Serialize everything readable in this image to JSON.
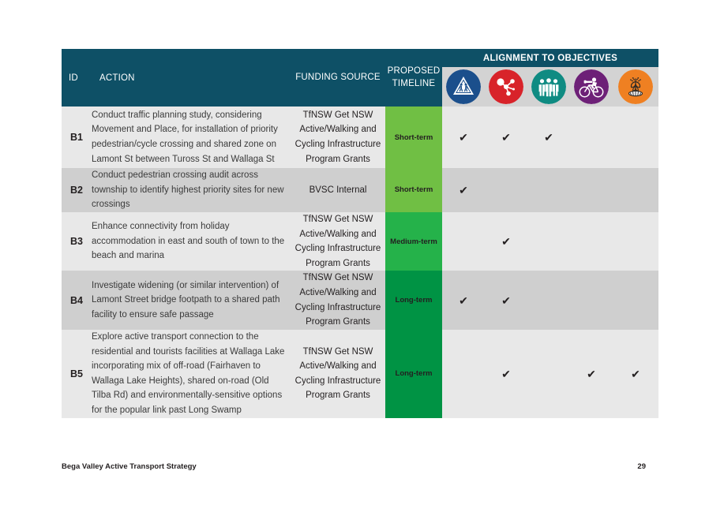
{
  "document": {
    "footer_title": "Bega Valley Active Transport Strategy",
    "page_number": "29"
  },
  "table": {
    "headers": {
      "id": "ID",
      "action": "ACTION",
      "funding_source": "FUNDING SOURCE",
      "proposed_timeline": "PROPOSED TIMELINE",
      "alignment_group": "ALIGNMENT TO OBJECTIVES"
    },
    "objectives": [
      {
        "name": "safety-pedestrian-crossing-icon",
        "color": "#1b4f8c",
        "label": "Safety"
      },
      {
        "name": "connected-network-icon",
        "color": "#d8232a",
        "label": "Connected network"
      },
      {
        "name": "community-people-icon",
        "color": "#0f8b82",
        "label": "Community"
      },
      {
        "name": "cycling-rider-icon",
        "color": "#6d2077",
        "label": "Cycling"
      },
      {
        "name": "environment-tree-icon",
        "color": "#ef8022",
        "label": "Environment"
      }
    ],
    "timeline_colors": {
      "short": "#70bf44",
      "medium": "#25b24a",
      "long": "#009344"
    },
    "header_color": "#0e5066",
    "tick_glyph": "✔",
    "rows": [
      {
        "id": "B1",
        "action": "Conduct traffic planning study, considering Movement and Place, for installation of priority pedestrian/cycle crossing and shared zone on Lamont St between Tuross St and Wallaga St",
        "funding_source": "TfNSW Get NSW Active/Walking and Cycling Infrastructure Program Grants",
        "timeline": "Short-term",
        "timeline_key": "short",
        "alignment": [
          true,
          true,
          true,
          false,
          false
        ],
        "shade": "light"
      },
      {
        "id": "B2",
        "action": "Conduct pedestrian crossing audit across township to identify highest priority sites for new crossings",
        "funding_source": "BVSC Internal",
        "timeline": "Short-term",
        "timeline_key": "short",
        "alignment": [
          true,
          false,
          false,
          false,
          false
        ],
        "shade": "dark"
      },
      {
        "id": "B3",
        "action": "Enhance connectivity from holiday accommodation in east and south of town to the beach and marina",
        "funding_source": "TfNSW Get NSW Active/Walking and Cycling Infrastructure Program Grants",
        "timeline": "Medium-term",
        "timeline_key": "medium",
        "alignment": [
          false,
          true,
          false,
          false,
          false
        ],
        "shade": "light"
      },
      {
        "id": "B4",
        "action": "Investigate widening (or similar intervention) of Lamont Street bridge footpath to a shared path facility to ensure safe passage",
        "funding_source": "TfNSW Get NSW Active/Walking and Cycling Infrastructure Program Grants",
        "timeline": "Long-term",
        "timeline_key": "long",
        "alignment": [
          true,
          true,
          false,
          false,
          false
        ],
        "shade": "dark"
      },
      {
        "id": "B5",
        "action": "Explore active transport connection to the residential and tourists facilities at Wallaga Lake incorporating mix of off-road (Fairhaven to Wallaga Lake Heights), shared on-road (Old Tilba Rd) and environmentally-sensitive options for the popular link past Long Swamp",
        "funding_source": "TfNSW Get NSW Active/Walking and Cycling Infrastructure Program Grants",
        "timeline": "Long-term",
        "timeline_key": "long",
        "alignment": [
          false,
          true,
          false,
          true,
          true
        ],
        "shade": "light"
      }
    ]
  }
}
